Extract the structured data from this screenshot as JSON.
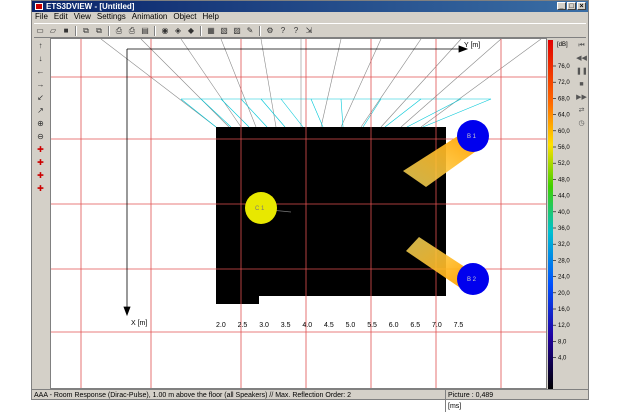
{
  "window": {
    "title": "ETS3DVIEW - [Untitled]",
    "min_glyph": "_",
    "max_glyph": "□",
    "close_glyph": "×"
  },
  "menu": [
    "File",
    "Edit",
    "View",
    "Settings",
    "Animation",
    "Object",
    "Help"
  ],
  "toolbar_icons": [
    {
      "name": "new-file-icon",
      "glyph": "▭"
    },
    {
      "name": "open-file-icon",
      "glyph": "▱"
    },
    {
      "name": "save-icon",
      "glyph": "■"
    },
    {
      "name": "copy-icon",
      "glyph": "⧉"
    },
    {
      "name": "paste-icon",
      "glyph": "⧉"
    },
    {
      "name": "print-icon",
      "glyph": "⎙"
    },
    {
      "name": "print-preview-icon",
      "glyph": "⎙"
    },
    {
      "name": "page-icon",
      "glyph": "▤"
    },
    {
      "name": "bulb-icon",
      "glyph": "◉"
    },
    {
      "name": "speaker-icon",
      "glyph": "◈"
    },
    {
      "name": "room-icon",
      "glyph": "◆"
    },
    {
      "name": "grid-icon",
      "glyph": "▦"
    },
    {
      "name": "image-icon",
      "glyph": "▧"
    },
    {
      "name": "chart-icon",
      "glyph": "▨"
    },
    {
      "name": "edit-icon",
      "glyph": "✎"
    },
    {
      "name": "settings-icon",
      "glyph": "⚙"
    },
    {
      "name": "help-icon",
      "glyph": "?"
    },
    {
      "name": "context-help-icon",
      "glyph": "?"
    },
    {
      "name": "export-icon",
      "glyph": "⇲"
    }
  ],
  "left_tools": [
    {
      "name": "arrow-up-icon",
      "glyph": "↑"
    },
    {
      "name": "arrow-down-icon",
      "glyph": "↓"
    },
    {
      "name": "arrow-left-icon",
      "glyph": "←"
    },
    {
      "name": "arrow-right-icon",
      "glyph": "→"
    },
    {
      "name": "diag-down-left-icon",
      "glyph": "↙"
    },
    {
      "name": "diag-up-right-icon",
      "glyph": "↗"
    },
    {
      "name": "zoom-in-icon",
      "glyph": "⊕"
    },
    {
      "name": "zoom-out-icon",
      "glyph": "⊖"
    },
    {
      "name": "rotate-1-icon",
      "glyph": "✚"
    },
    {
      "name": "rotate-2-icon",
      "glyph": "✚"
    },
    {
      "name": "rotate-3-icon",
      "glyph": "✚"
    },
    {
      "name": "rotate-4-icon",
      "glyph": "✚"
    }
  ],
  "right_tools": [
    {
      "name": "rewind-icon",
      "glyph": "⏮"
    },
    {
      "name": "step-back-icon",
      "glyph": "◀◀"
    },
    {
      "name": "pause-icon",
      "glyph": "❚❚"
    },
    {
      "name": "stop-icon",
      "glyph": "■"
    },
    {
      "name": "step-forward-icon",
      "glyph": "▶▶"
    },
    {
      "name": "loop-icon",
      "glyph": "⇄"
    },
    {
      "name": "clock-icon",
      "glyph": "◷"
    }
  ],
  "plot": {
    "y_axis_label": "Y [m]",
    "x_axis_label": "X [m]",
    "x_ticks": [
      "2.0",
      "2.5",
      "3.0",
      "3.5",
      "4.0",
      "4.5",
      "5.0",
      "5.5",
      "6.0",
      "6.5",
      "7.0",
      "7.5"
    ],
    "speakers": [
      {
        "id": "C-1",
        "label": "C 1",
        "color": "#e8e800"
      },
      {
        "id": "B-1",
        "label": "B 1",
        "color": "#0000ee"
      },
      {
        "id": "B-2",
        "label": "B 2",
        "color": "#0000ee"
      }
    ]
  },
  "scale": {
    "unit": "[dB]",
    "ticks": [
      "76,0",
      "72,0",
      "68,0",
      "64,0",
      "60,0",
      "56,0",
      "52,0",
      "48,0",
      "44,0",
      "40,0",
      "36,0",
      "32,0",
      "28,0",
      "24,0",
      "20,0",
      "16,0",
      "12,0",
      "8,0",
      "4,0"
    ]
  },
  "status": {
    "main": "AAA - Room Response (Dirac-Pulse), 1.00 m above the floor (all Speakers) // Max. Reflection Order: 2",
    "picture": "Picture : 0,489 [ms]",
    "extra": ""
  },
  "colors": {
    "titlebar": "#0a246a",
    "grid": "#e05050",
    "room": "#000000",
    "speaker_yellow": "#e8e800",
    "speaker_blue": "#0000ee",
    "ray": "#ffb000",
    "perspective": "#00c8d8"
  }
}
